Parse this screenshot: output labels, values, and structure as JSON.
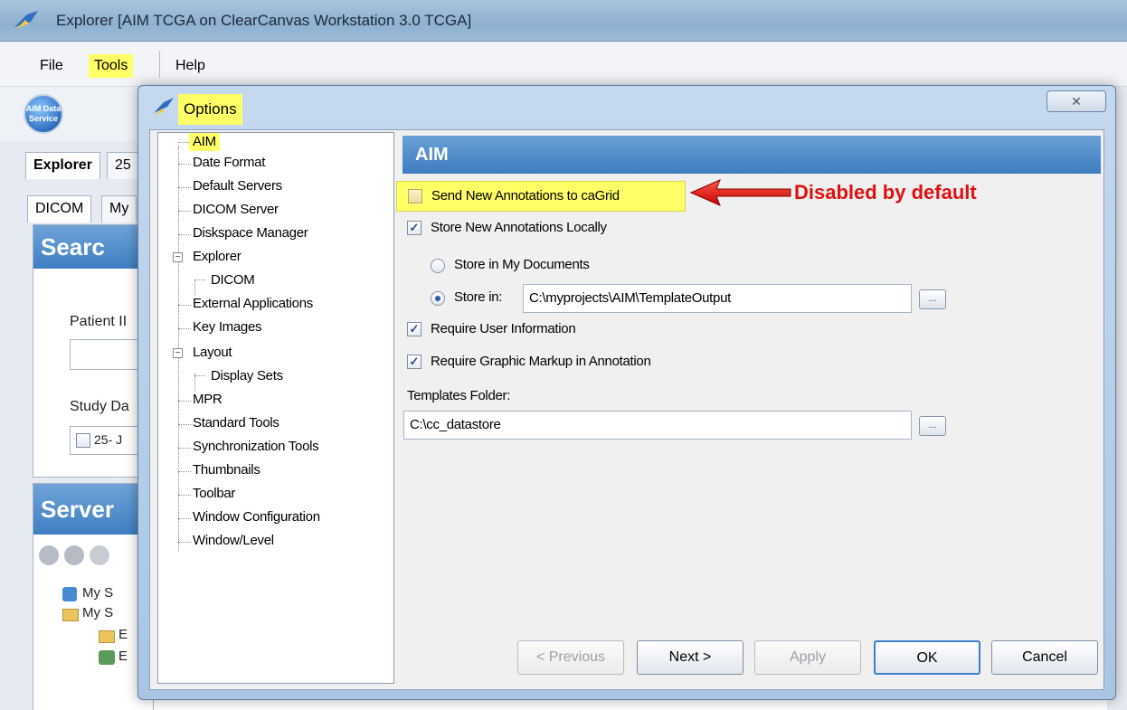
{
  "main_window": {
    "title": "Explorer [AIM TCGA on ClearCanvas Workstation 3.0 TCGA]",
    "menu": {
      "file": "File",
      "tools": "Tools",
      "help": "Help"
    },
    "logo_text": "AIM Data Service",
    "tabs": {
      "explorer": "Explorer",
      "second": "25"
    },
    "subtabs": {
      "dicom": "DICOM",
      "my": "My"
    },
    "search_panel": {
      "title": "Searc",
      "patient_label": "Patient II",
      "study_date_label": "Study Da",
      "study_date_value": "25- J"
    },
    "server_panel": {
      "title": "Server",
      "items": [
        "My S",
        "My S",
        "E",
        "E"
      ]
    }
  },
  "dialog": {
    "title": "Options",
    "close_glyph": "✕",
    "tree": {
      "aim": "AIM",
      "date_format": "Date Format",
      "default_servers": "Default Servers",
      "dicom_server": "DICOM Server",
      "diskspace_manager": "Diskspace Manager",
      "explorer": "Explorer",
      "explorer_dicom": "DICOM",
      "external_applications": "External Applications",
      "key_images": "Key Images",
      "layout": "Layout",
      "display_sets": "Display Sets",
      "mpr": "MPR",
      "standard_tools": "Standard Tools",
      "synchronization_tools": "Synchronization Tools",
      "thumbnails": "Thumbnails",
      "toolbar": "Toolbar",
      "window_configuration": "Window Configuration",
      "window_level": "Window/Level"
    },
    "settings": {
      "header": "AIM",
      "send_to_cagrid": {
        "label": "Send New Annotations to caGrid",
        "checked": false
      },
      "store_locally": {
        "label": "Store New Annotations Locally",
        "checked": true
      },
      "store_in_my_documents": {
        "label": "Store in My Documents",
        "selected": false
      },
      "store_in": {
        "label": "Store in:",
        "selected": true,
        "path": "C:\\myprojects\\AIM\\TemplateOutput"
      },
      "require_user_info": {
        "label": "Require User Information",
        "checked": true
      },
      "require_graphic_markup": {
        "label": "Require Graphic Markup in Annotation",
        "checked": true
      },
      "templates_folder": {
        "label": "Templates Folder:",
        "path": "C:\\cc_datastore"
      },
      "browse_label": "...",
      "check_glyph": "✓"
    },
    "buttons": {
      "previous": "< Previous",
      "next": "Next >",
      "apply": "Apply",
      "ok": "OK",
      "cancel": "Cancel"
    }
  },
  "annotation_text": "Disabled by default",
  "colors": {
    "highlight": "#ffff66",
    "annotation_red": "#e01010",
    "header_blue": "#3e7dc0"
  }
}
